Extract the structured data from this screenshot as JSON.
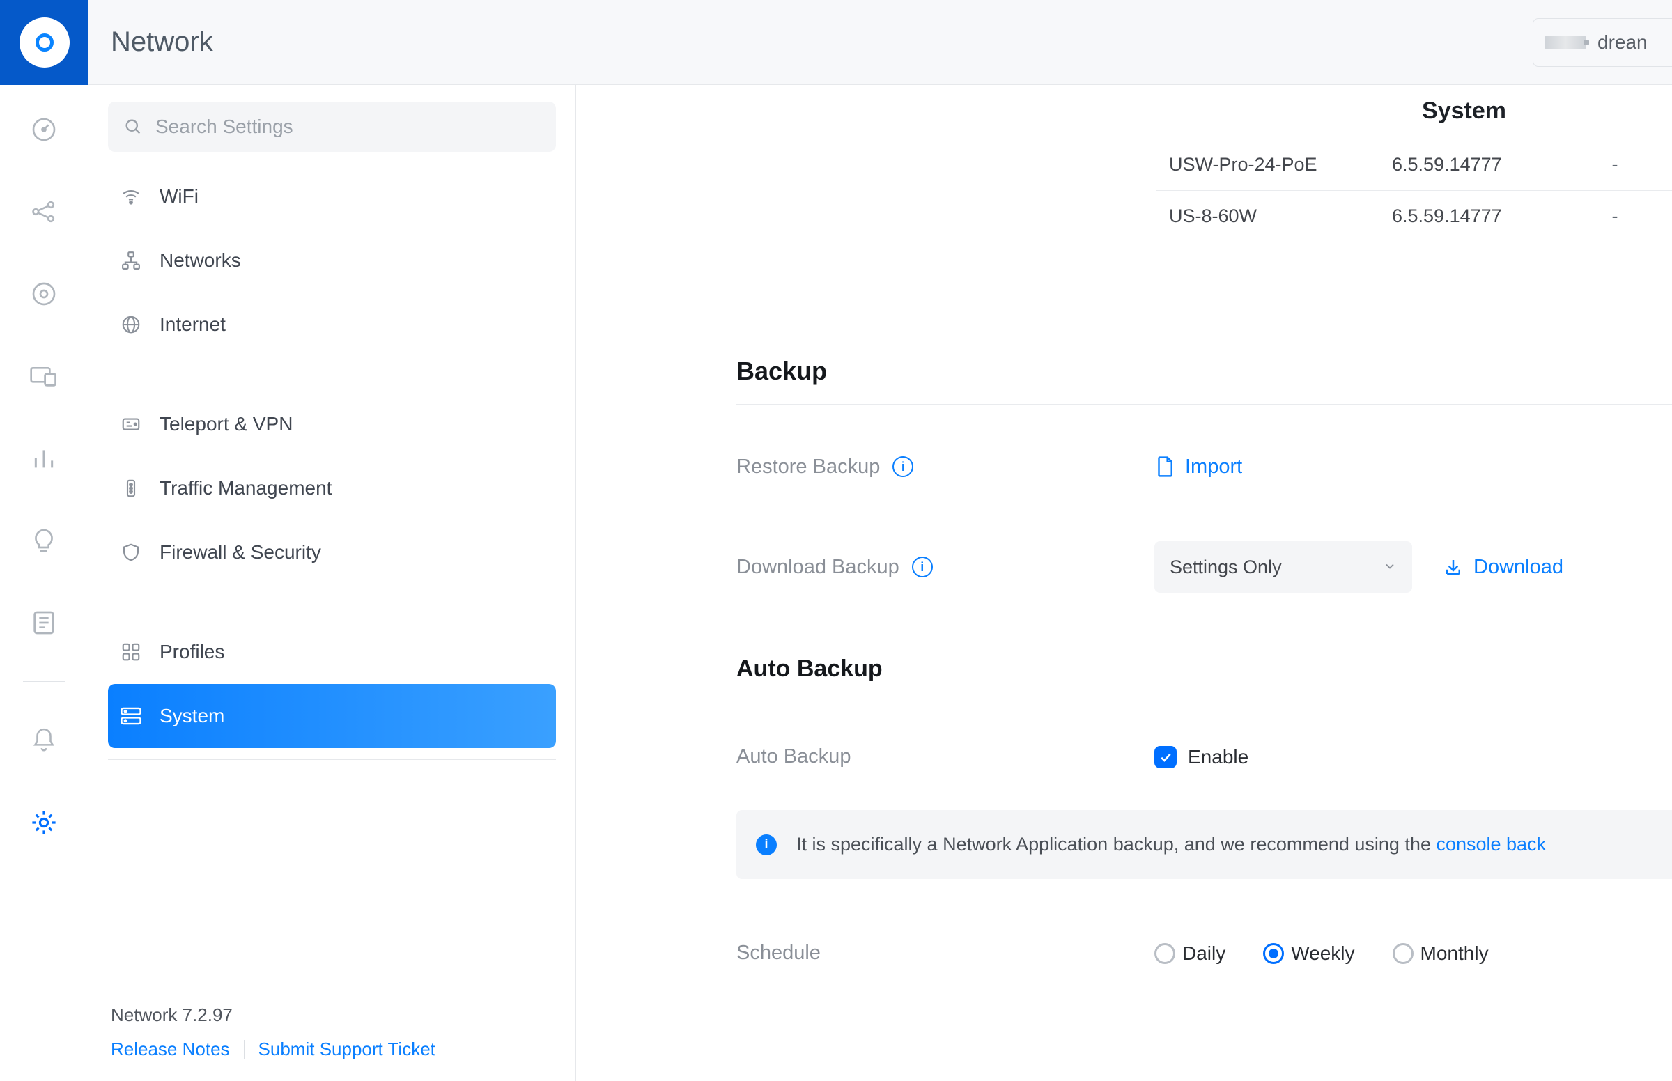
{
  "header": {
    "title": "Network",
    "device_name": "drean"
  },
  "search": {
    "placeholder": "Search Settings"
  },
  "nav": {
    "wifi": "WiFi",
    "networks": "Networks",
    "internet": "Internet",
    "teleport_vpn": "Teleport & VPN",
    "traffic_mgmt": "Traffic Management",
    "firewall_sec": "Firewall & Security",
    "profiles": "Profiles",
    "system": "System"
  },
  "footer": {
    "version": "Network 7.2.97",
    "release_notes": "Release Notes",
    "support": "Submit Support Ticket"
  },
  "system": {
    "heading": "System",
    "rows": [
      {
        "name": "USW-Pro-24-PoE",
        "version": "6.5.59.14777",
        "extra": "-"
      },
      {
        "name": "US-8-60W",
        "version": "6.5.59.14777",
        "extra": "-"
      }
    ]
  },
  "backup": {
    "title": "Backup",
    "restore_label": "Restore Backup",
    "import": "Import",
    "download_label": "Download Backup",
    "select_value": "Settings Only",
    "download": "Download"
  },
  "auto_backup": {
    "title": "Auto Backup",
    "label": "Auto Backup",
    "enable": "Enable",
    "info_text": "It is specifically a Network Application backup, and we recommend using the ",
    "info_link": "console back",
    "schedule_label": "Schedule",
    "options": {
      "daily": "Daily",
      "weekly": "Weekly",
      "monthly": "Monthly"
    }
  }
}
